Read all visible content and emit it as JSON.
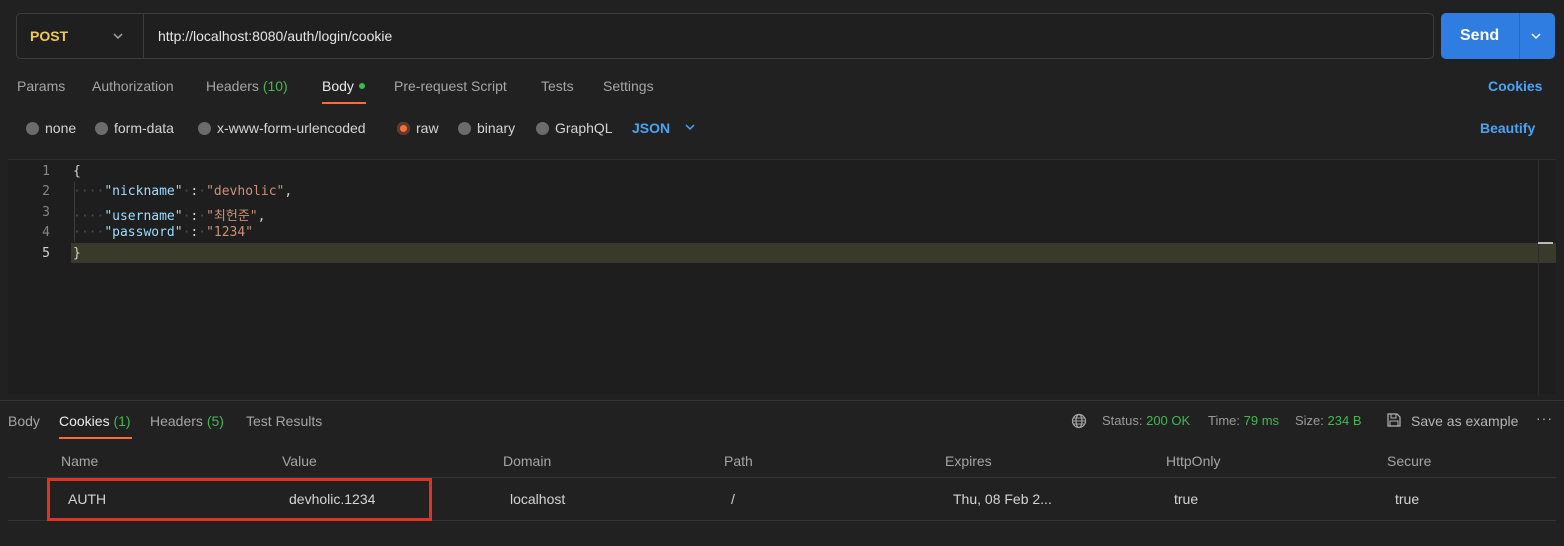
{
  "request": {
    "method": "POST",
    "url": "http://localhost:8080/auth/login/cookie",
    "send_label": "Send"
  },
  "request_tabs": {
    "params": "Params",
    "authorization": "Authorization",
    "headers": "Headers",
    "headers_count": "(10)",
    "body": "Body",
    "pre_request": "Pre-request Script",
    "tests": "Tests",
    "settings": "Settings",
    "cookies": "Cookies"
  },
  "body_types": {
    "none": "none",
    "form_data": "form-data",
    "urlencoded": "x-www-form-urlencoded",
    "raw": "raw",
    "binary": "binary",
    "graphql": "GraphQL",
    "selected": "raw",
    "format": "JSON",
    "beautify": "Beautify"
  },
  "editor": {
    "line_numbers": [
      "1",
      "2",
      "3",
      "4",
      "5"
    ],
    "open_brace": "{",
    "close_brace": "}",
    "fields": [
      {
        "key": "\"nickname\"",
        "value": "\"devholic\"",
        "comma": ","
      },
      {
        "key": "\"username\"",
        "value": "\"최헌준\"",
        "comma": ","
      },
      {
        "key": "\"password\"",
        "value": "\"1234\"",
        "comma": ""
      }
    ]
  },
  "response_tabs": {
    "body": "Body",
    "cookies": "Cookies",
    "cookies_count": "(1)",
    "headers": "Headers",
    "headers_count": "(5)",
    "test_results": "Test Results"
  },
  "response_meta": {
    "status_label": "Status:",
    "status_value": "200 OK",
    "time_label": "Time:",
    "time_value": "79 ms",
    "size_label": "Size:",
    "size_value": "234 B",
    "save_example": "Save as example",
    "more": "···"
  },
  "cookies_table": {
    "columns": [
      "Name",
      "Value",
      "Domain",
      "Path",
      "Expires",
      "HttpOnly",
      "Secure"
    ],
    "rows": [
      [
        "AUTH",
        "devholic.1234",
        "localhost",
        "/",
        "Thu, 08 Feb 2...",
        "true",
        "true"
      ]
    ]
  },
  "colors": {
    "accent": "#ff6c37",
    "send": "#2f7de0",
    "link": "#4aa3f5",
    "success": "#3fb950",
    "method": "#f2c94c",
    "highlight_box": "#e03327"
  }
}
